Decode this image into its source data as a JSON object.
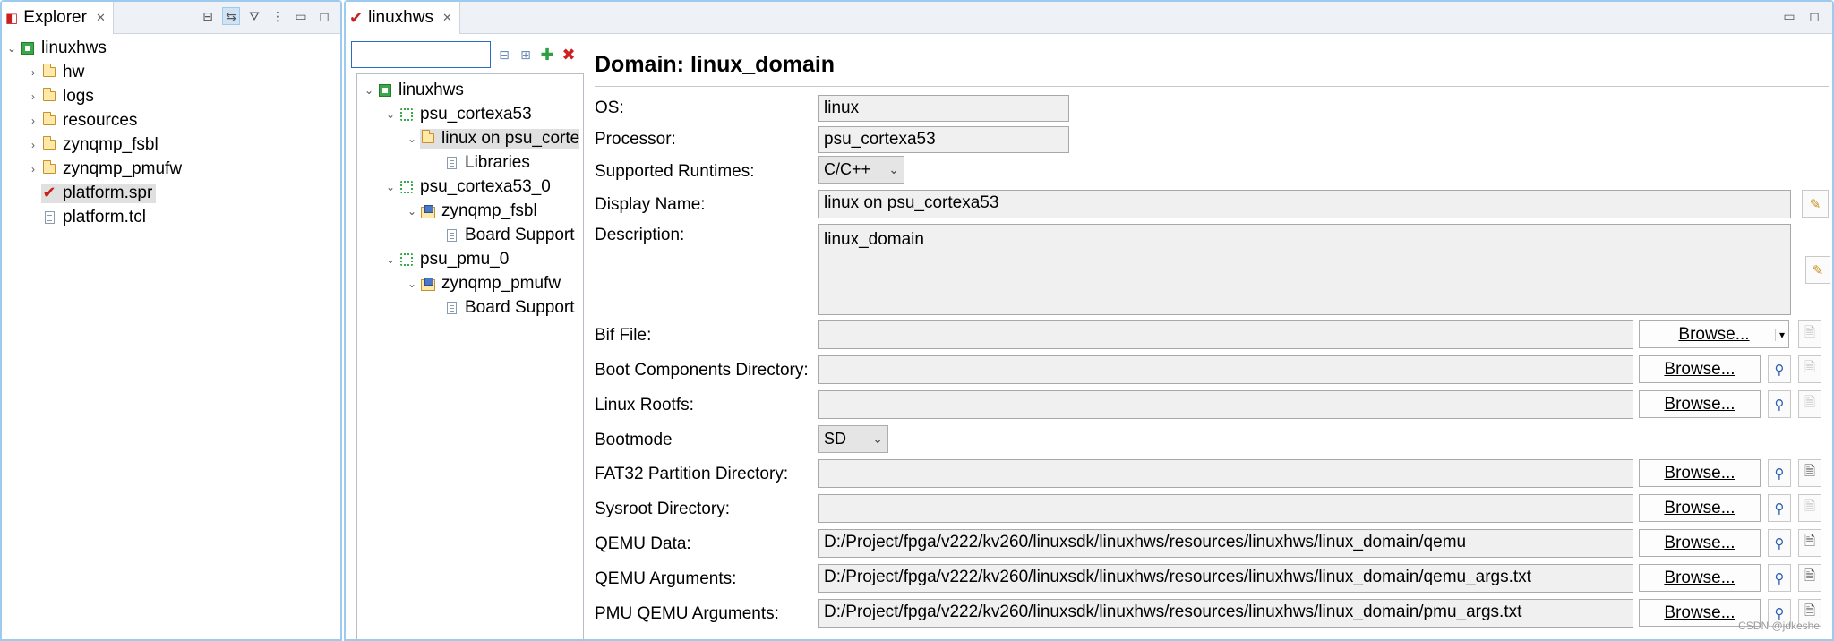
{
  "explorer": {
    "tab_label": "Explorer",
    "tree": [
      {
        "label": "linuxhws",
        "icon": "project-icon",
        "expanded": true,
        "level": 0
      },
      {
        "label": "hw",
        "icon": "folder-icon",
        "level": 1
      },
      {
        "label": "logs",
        "icon": "folder-icon",
        "level": 1
      },
      {
        "label": "resources",
        "icon": "folder-icon",
        "level": 1
      },
      {
        "label": "zynqmp_fsbl",
        "icon": "folder-icon",
        "level": 1
      },
      {
        "label": "zynqmp_pmufw",
        "icon": "folder-icon",
        "level": 1
      },
      {
        "label": "platform.spr",
        "icon": "spr-file-icon",
        "level": 1,
        "selected": true
      },
      {
        "label": "platform.tcl",
        "icon": "file-icon",
        "level": 1
      }
    ]
  },
  "editor": {
    "tab_label": "linuxhws",
    "filter_value": "",
    "platform_tree": [
      {
        "label": "linuxhws",
        "icon": "project-icon",
        "level": 0,
        "expanded": true
      },
      {
        "label": "psu_cortexa53",
        "icon": "processor-icon",
        "level": 1,
        "expanded": true
      },
      {
        "label": "linux on psu_corte",
        "icon": "domain-folder-icon",
        "level": 2,
        "expanded": true,
        "selected": true
      },
      {
        "label": "Libraries",
        "icon": "file-icon",
        "level": 3
      },
      {
        "label": "psu_cortexa53_0",
        "icon": "processor-icon",
        "level": 1,
        "expanded": true
      },
      {
        "label": "zynqmp_fsbl",
        "icon": "bsp-icon",
        "level": 2,
        "expanded": true
      },
      {
        "label": "Board Support",
        "icon": "file-icon",
        "level": 3
      },
      {
        "label": "psu_pmu_0",
        "icon": "processor-icon",
        "level": 1,
        "expanded": true
      },
      {
        "label": "zynqmp_pmufw",
        "icon": "bsp-icon",
        "level": 2,
        "expanded": true
      },
      {
        "label": "Board Support",
        "icon": "file-icon",
        "level": 3
      }
    ]
  },
  "form": {
    "title": "Domain: linux_domain",
    "os": {
      "label": "OS:",
      "value": "linux"
    },
    "processor": {
      "label": "Processor:",
      "value": "psu_cortexa53"
    },
    "runtimes": {
      "label": "Supported Runtimes:",
      "value": "C/C++"
    },
    "display_name": {
      "label": "Display Name:",
      "value": "linux on psu_cortexa53"
    },
    "description": {
      "label": "Description:",
      "value": "linux_domain"
    },
    "bif_file": {
      "label": "Bif File:",
      "value": ""
    },
    "boot_dir": {
      "label": "Boot Components Directory:",
      "value": ""
    },
    "rootfs": {
      "label": "Linux Rootfs:",
      "value": ""
    },
    "bootmode": {
      "label": "Bootmode",
      "value": "SD"
    },
    "fat32_dir": {
      "label": "FAT32 Partition Directory:",
      "value": ""
    },
    "sysroot_dir": {
      "label": "Sysroot Directory:",
      "value": ""
    },
    "qemu_data": {
      "label": "QEMU Data:",
      "value": "D:/Project/fpga/v222/kv260/linuxsdk/linuxhws/resources/linuxhws/linux_domain/qemu"
    },
    "qemu_args": {
      "label": "QEMU Arguments:",
      "value": "D:/Project/fpga/v222/kv260/linuxsdk/linuxhws/resources/linuxhws/linux_domain/qemu_args.txt"
    },
    "pmu_qemu_args": {
      "label": "PMU QEMU Arguments:",
      "value": "D:/Project/fpga/v222/kv260/linuxsdk/linuxhws/resources/linuxhws/linux_domain/pmu_args.txt"
    },
    "browse_label": "Browse..."
  },
  "watermark": "CSDN @jdkeshe"
}
